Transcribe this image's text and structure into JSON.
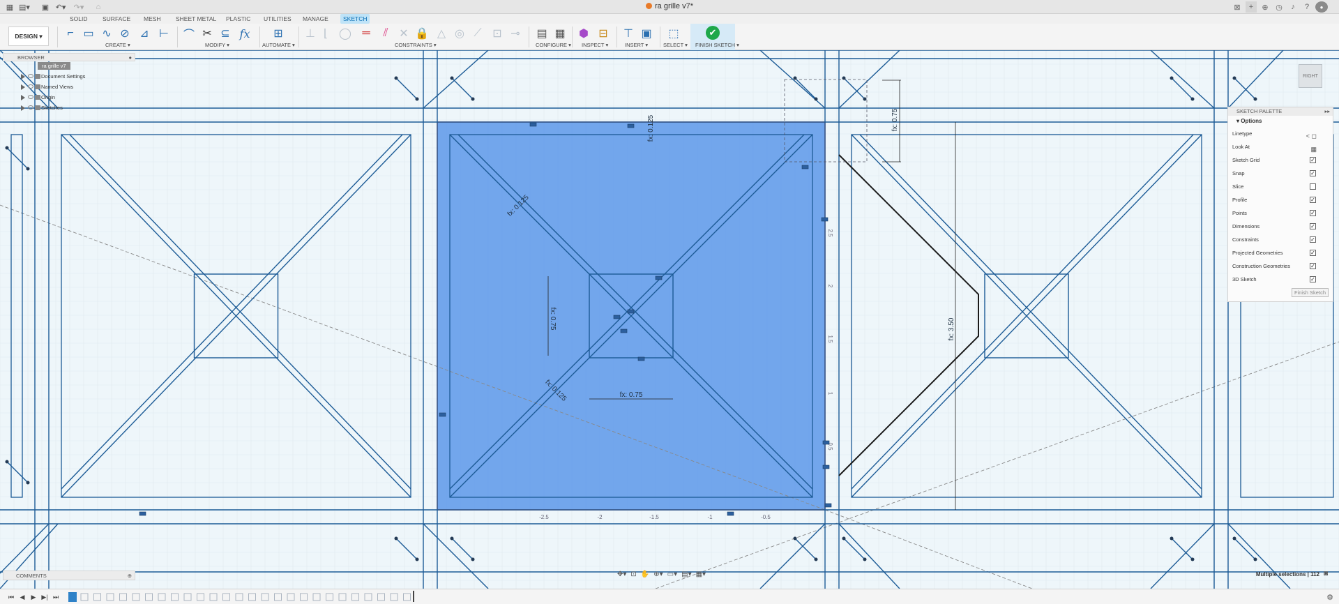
{
  "app": {
    "document_title": "ra grille v7*"
  },
  "ribbon": {
    "tabs": [
      "SOLID",
      "SURFACE",
      "MESH",
      "SHEET METAL",
      "PLASTIC",
      "UTILITIES",
      "MANAGE",
      "SKETCH"
    ],
    "active_tab": "SKETCH",
    "workspace": "DESIGN ▾",
    "groups": {
      "create": "CREATE ▾",
      "modify": "MODIFY ▾",
      "automate": "AUTOMATE ▾",
      "constraints": "CONSTRAINTS ▾",
      "configure": "CONFIGURE ▾",
      "inspect": "INSPECT ▾",
      "insert": "INSERT ▾",
      "select": "SELECT ▾",
      "finish": "FINISH SKETCH ▾"
    }
  },
  "browser": {
    "title": "BROWSER",
    "root": "ra grille v7",
    "items": [
      "Document Settings",
      "Named Views",
      "Origin",
      "Sketches"
    ]
  },
  "palette": {
    "title": "SKETCH PALETTE",
    "section": "Options",
    "rows": [
      {
        "label": "Linetype",
        "kind": "icon",
        "icon": "linetype-icon"
      },
      {
        "label": "Look At",
        "kind": "icon",
        "icon": "look-at-icon"
      },
      {
        "label": "Sketch Grid",
        "kind": "check",
        "checked": true
      },
      {
        "label": "Snap",
        "kind": "check",
        "checked": true
      },
      {
        "label": "Slice",
        "kind": "check",
        "checked": false
      },
      {
        "label": "Profile",
        "kind": "check",
        "checked": true
      },
      {
        "label": "Points",
        "kind": "check",
        "checked": true
      },
      {
        "label": "Dimensions",
        "kind": "check",
        "checked": true
      },
      {
        "label": "Constraints",
        "kind": "check",
        "checked": true
      },
      {
        "label": "Projected Geometries",
        "kind": "check",
        "checked": true
      },
      {
        "label": "Construction Geometries",
        "kind": "check",
        "checked": true
      },
      {
        "label": "3D Sketch",
        "kind": "check",
        "checked": true
      }
    ],
    "finish_button": "Finish Sketch"
  },
  "viewcube": {
    "face": "RIGHT"
  },
  "comments": {
    "title": "COMMENTS"
  },
  "status": {
    "selection": "Multiple selections | 112"
  },
  "sketch": {
    "dimensions": {
      "top_small": "fx: 0.125",
      "diag_upper": "fx: 0.125",
      "inner_vertical": "fx: 0.75",
      "inner_horizontal": "fx: 0.75",
      "diag_lower": "fx: 0.125",
      "right_top": "fx: 0.75",
      "right_tall": "fx: 3.50"
    },
    "ruler_bottom": [
      "-2.5",
      "-2",
      "-1.5",
      "-1",
      "-0.5"
    ],
    "ruler_right": [
      "2.5",
      "2",
      "1.5",
      "1",
      "0.5"
    ]
  },
  "colors": {
    "canvas_bg": "#eef6fa",
    "line": "#1c5b96",
    "selection_fill": "#4f8fe8",
    "selection_border": "#d94a4a",
    "accent": "#0a6fb6",
    "finish_green": "#1fa84a"
  }
}
